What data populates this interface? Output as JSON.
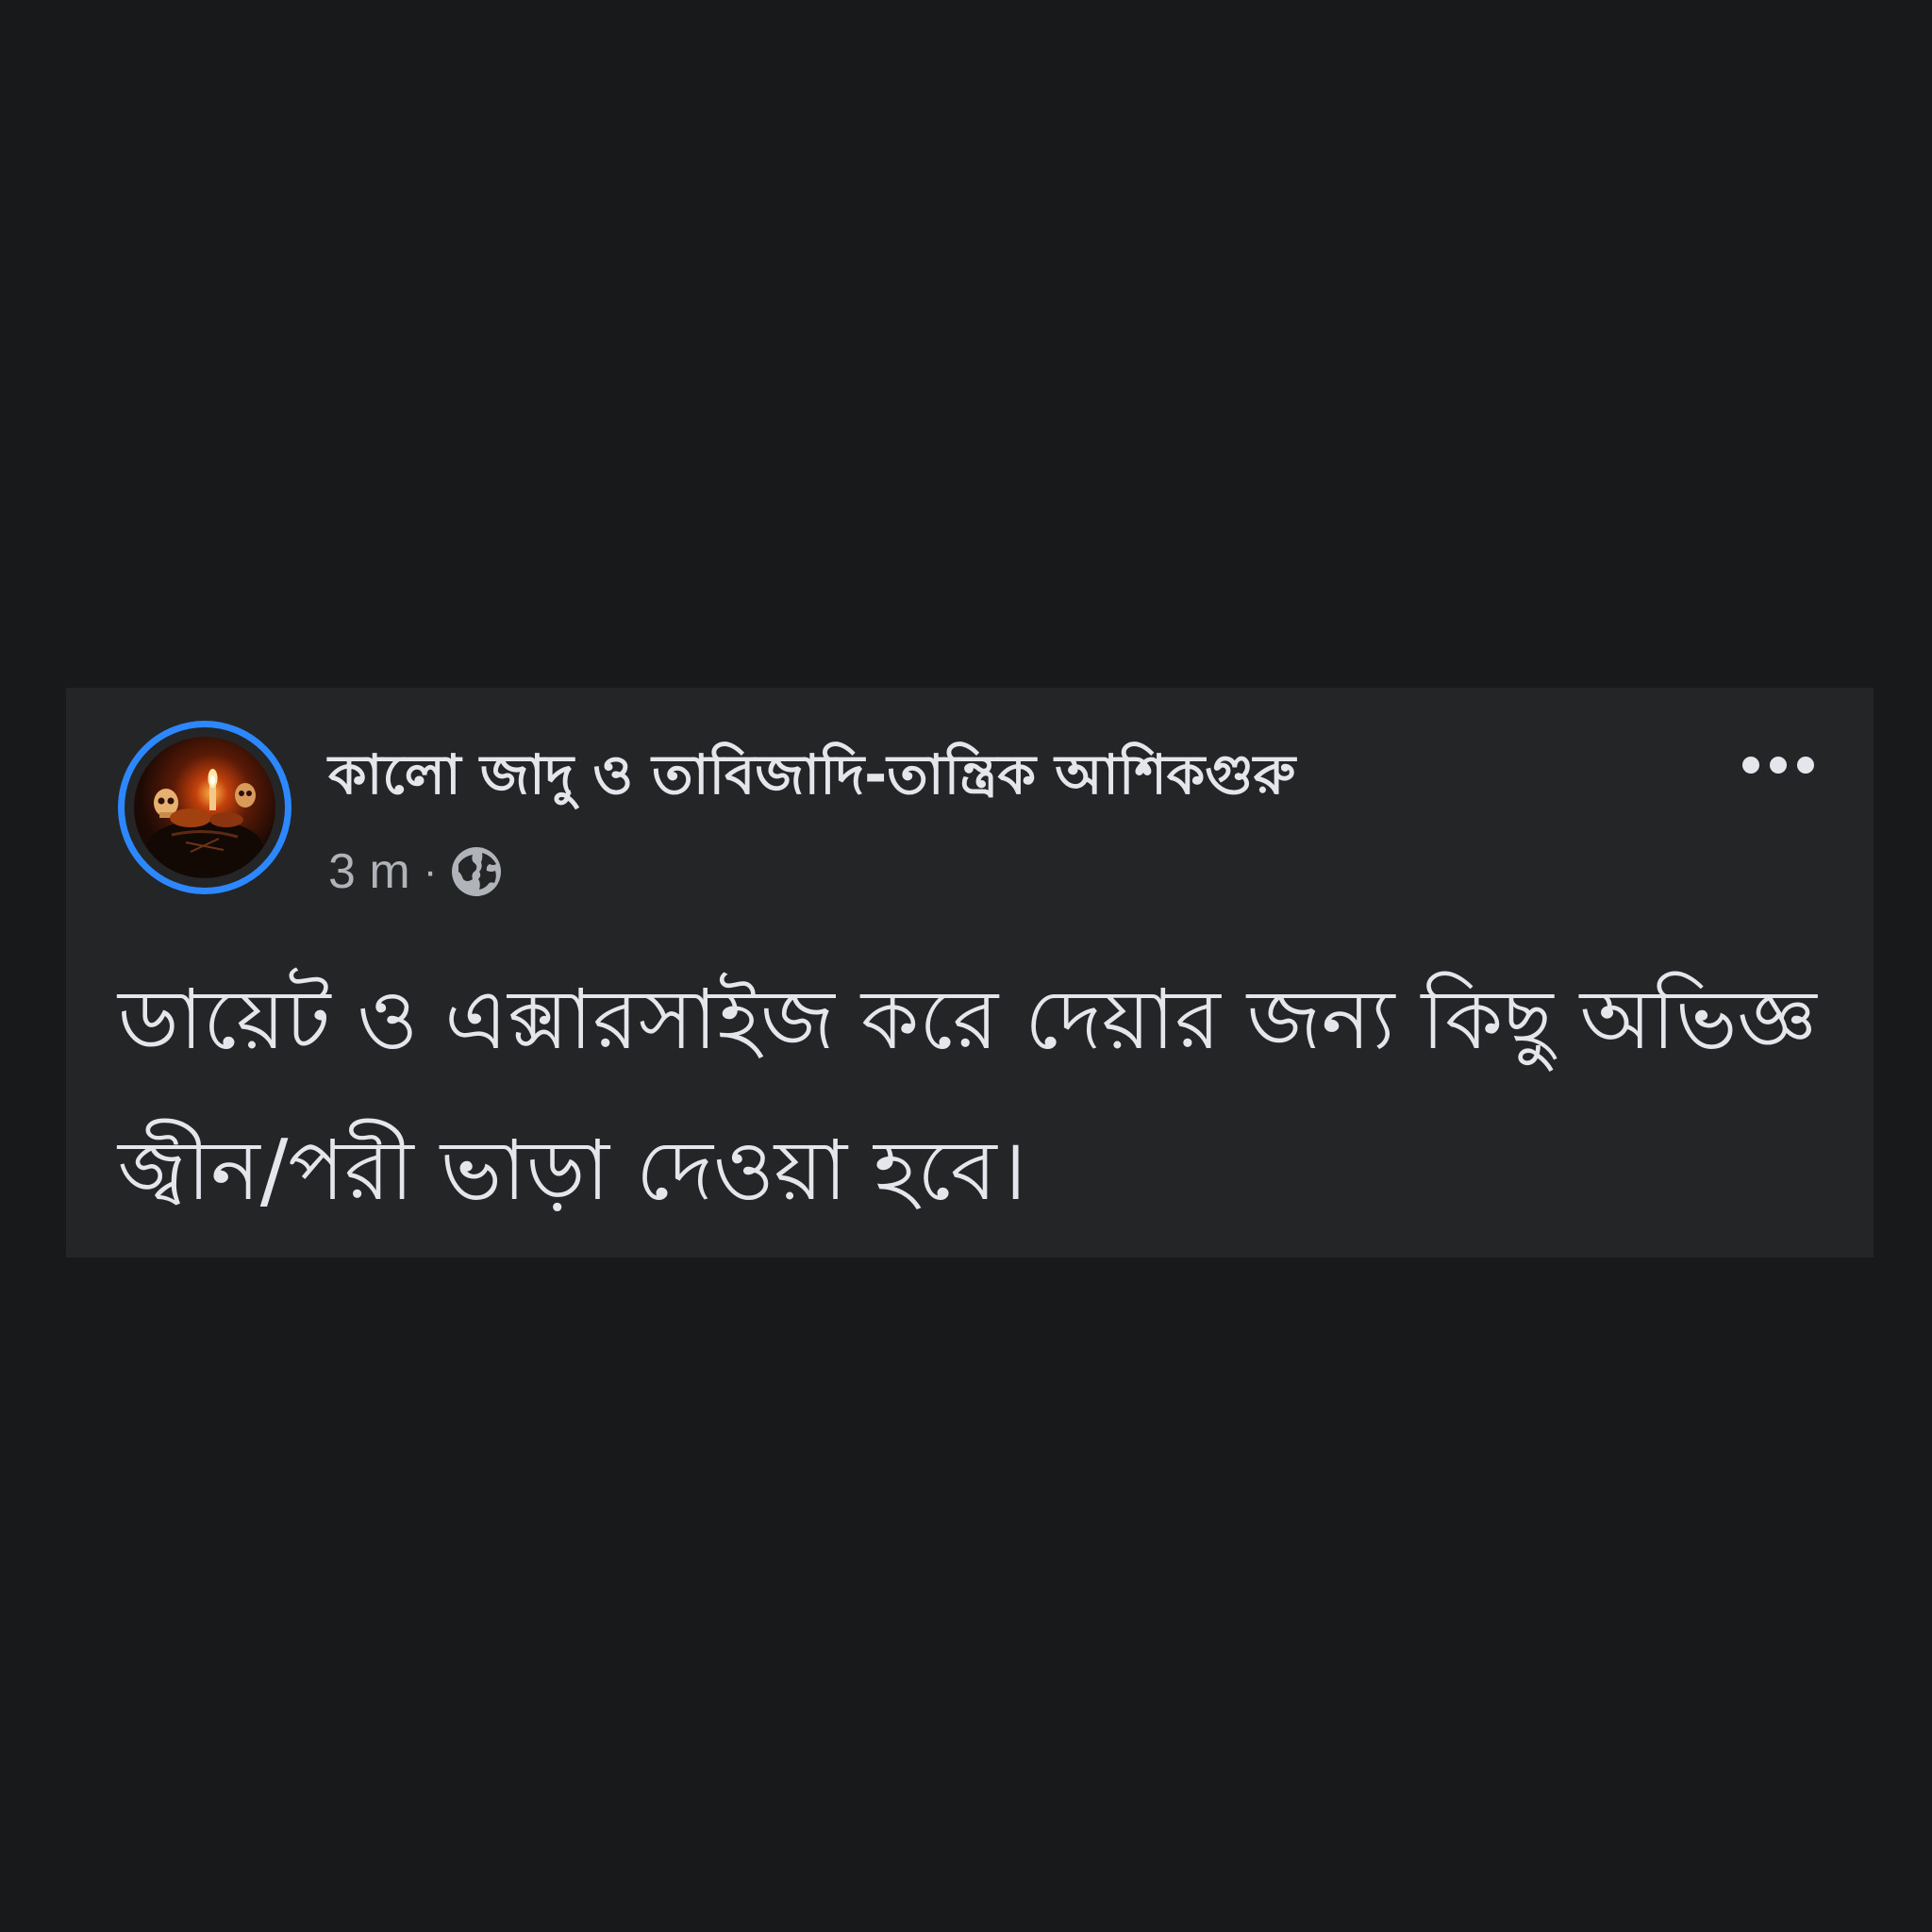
{
  "post": {
    "author_name": "কালো জাদু ও তাবিজাদি-তান্ত্রিক আশিকগুরু",
    "timestamp": "3 m",
    "separator": "·",
    "audience_icon": "globe-icon",
    "more_icon": "more-options-icon",
    "text": "ডায়েট ও এক্সারসাইজ করে দেয়ার জন্য কিছু অভিজ্ঞ জ্বীন/পরী ভাড়া দেওয়া হবে।"
  },
  "colors": {
    "page_background": "#18191a",
    "card_background": "#242526",
    "avatar_ring": "#2d88ff",
    "primary_text": "#e4e6eb",
    "secondary_text": "#b0b3b8"
  }
}
